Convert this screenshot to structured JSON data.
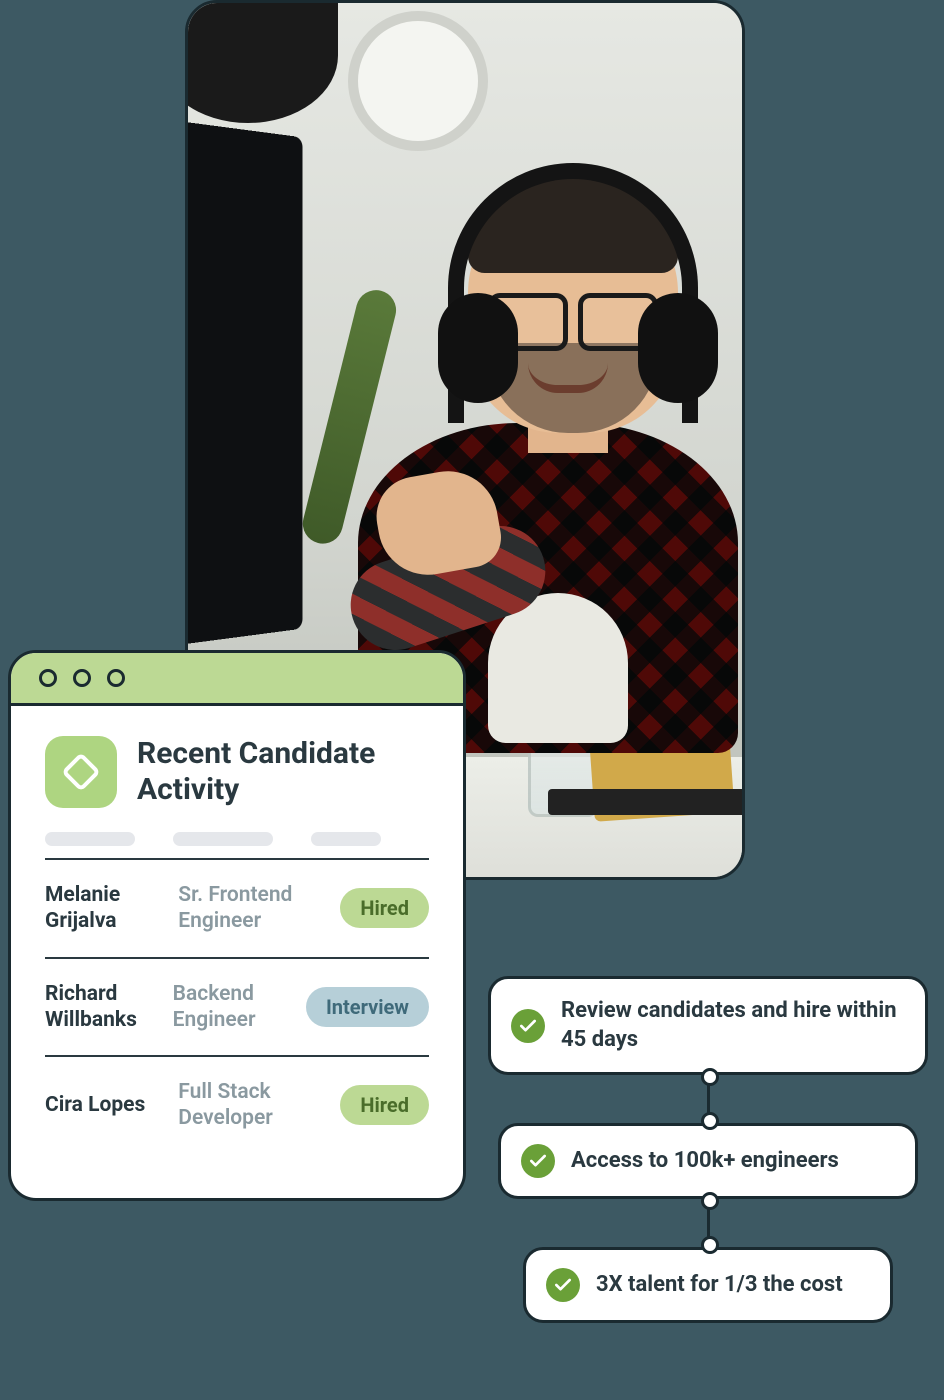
{
  "activity": {
    "title": "Recent Candidate Activity",
    "rows": [
      {
        "name": "Melanie Grijalva",
        "role": "Sr. Frontend Engineer",
        "status": "Hired",
        "status_kind": "hired"
      },
      {
        "name": "Richard Willbanks",
        "role": "Backend Engineer",
        "status": "Interview",
        "status_kind": "interview"
      },
      {
        "name": "Cira Lopes",
        "role": "Full Stack Developer",
        "status": "Hired",
        "status_kind": "hired"
      }
    ]
  },
  "features": [
    "Review candidates and hire within 45 days",
    "Access to 100k+ engineers",
    "3X talent for 1/3 the cost"
  ],
  "colors": {
    "bg": "#3d5963",
    "accent_green": "#aed581",
    "chrome_green": "#bcd994",
    "check_green": "#6aa038",
    "pill_interview": "#b6cfd8",
    "text_dark": "#2a3940",
    "text_muted": "#8a99a0"
  }
}
